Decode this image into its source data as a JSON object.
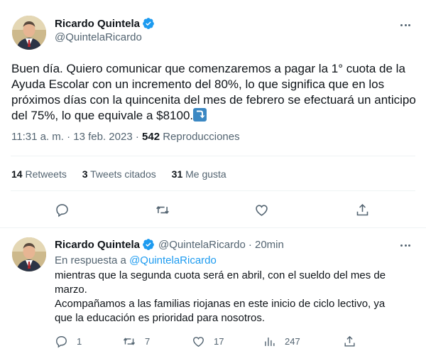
{
  "colors": {
    "accent": "#1d9bf0",
    "text": "#0f1419",
    "muted": "#536471",
    "border": "#eff3f4"
  },
  "main_tweet": {
    "author_name": "Ricardo Quintela",
    "author_handle": "@QuintelaRicardo",
    "text": "Buen día. Quiero comunicar que comenzaremos a pagar la 1° cuota de la Ayuda Escolar con un incremento del 80%, lo que significa que en los próximos días con la quincenita del mes de febrero se efectuará un anticipo del 75%, lo que equivale a $8100.",
    "emoji": "arrow-heading-down-icon",
    "time": "11:31 a. m. · 13 feb. 2023 ·",
    "views_count": "542",
    "views_label": "Reproducciones",
    "retweets_count": "14",
    "retweets_label": "Retweets",
    "quotes_count": "3",
    "quotes_label": "Tweets citados",
    "likes_count": "31",
    "likes_label": "Me gusta"
  },
  "reply_tweet": {
    "author_name": "Ricardo Quintela",
    "author_handle": "@QuintelaRicardo",
    "time": "· 20min",
    "in_reply_to_prefix": "En respuesta a",
    "in_reply_to_handle": "@QuintelaRicardo",
    "line1": "mientras que la segunda cuota será en abril, con el sueldo del mes de",
    "line2": "marzo.",
    "line3": "Acompañamos a las familias riojanas en este inicio de ciclo lectivo, ya",
    "line4": "que la educación es prioridad para nosotros.",
    "reply_count": "1",
    "retweet_count": "7",
    "like_count": "17",
    "views_count": "247"
  }
}
